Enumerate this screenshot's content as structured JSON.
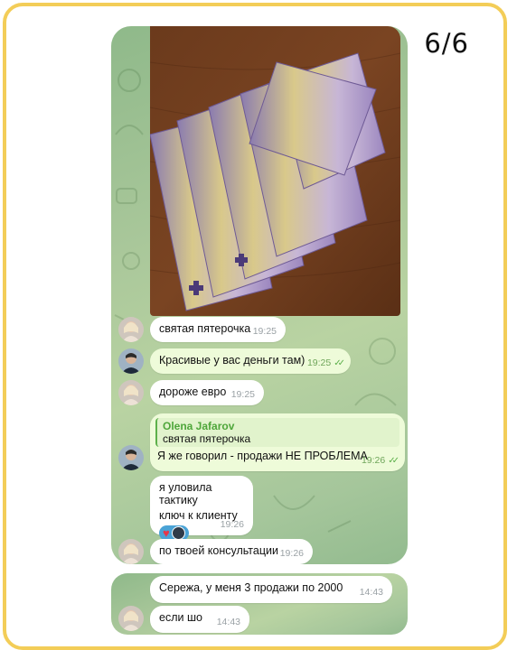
{
  "counter": "6/6",
  "messages": [
    {
      "text": "святая пятерочка",
      "time": "19:25"
    },
    {
      "text": "Красивые у вас деньги там)",
      "time": "19:25"
    },
    {
      "text": "дороже евро",
      "time": "19:25"
    },
    {
      "quote_name": "Olena Jafarov",
      "quote_text": "святая пятерочка",
      "text": "Я же говорил - продажи НЕ ПРОБЛЕМА",
      "time": "19:26"
    },
    {
      "line1": "я уловила тактику",
      "line2": "ключ к клиенту",
      "time": "19:26"
    },
    {
      "text": "по твоей консультации",
      "time": "19:26"
    },
    {
      "text": "Сережа, у меня 3 продажи по 2000",
      "time": "14:43"
    },
    {
      "text": "если шо",
      "time": "14:43"
    }
  ],
  "colors": {
    "frame": "#f3cd58",
    "outgoing_bubble": "#eefbd9",
    "read_checks": "#5cb04a",
    "quote_name": "#4ea63a"
  },
  "icons": {
    "read": "double-check-icon",
    "reaction": "heart-icon"
  }
}
